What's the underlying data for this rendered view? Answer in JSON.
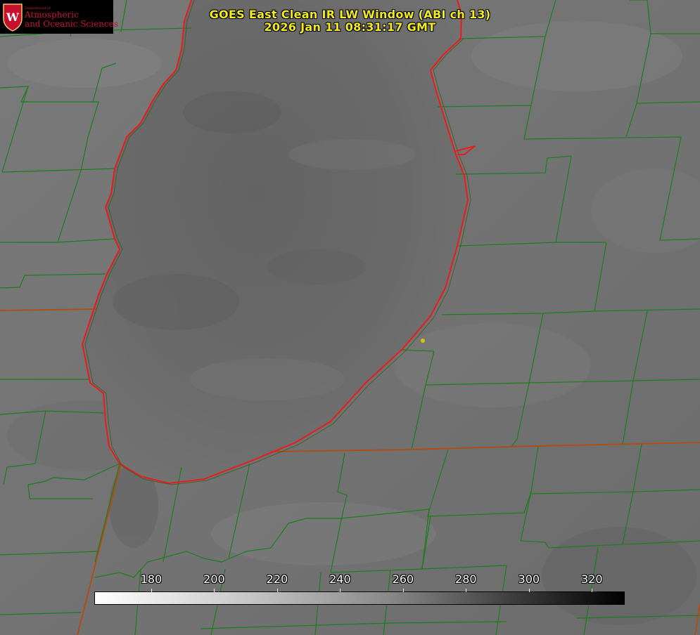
{
  "title": {
    "line1": "GOES East Clean IR LW Window (ABI ch 13)",
    "line2": "2026 Jan 11 08:31:17 GMT"
  },
  "logo": {
    "department": "Department of",
    "line1": "Atmospheric",
    "line2": "and Oceanic Sciences",
    "brand_color": "#c8102e"
  },
  "colorbar": {
    "unit_min": 161.9,
    "unit_max": 330,
    "ticks": [
      "180",
      "200",
      "220",
      "240",
      "260",
      "280",
      "300",
      "320"
    ]
  },
  "map": {
    "county_line_color": "#1c7d1c",
    "state_line_color": "#b34a10",
    "coastline_color": "#e81c1c",
    "station_marker_color": "#d4c21a",
    "lake_name": "",
    "background_gray": "#6e6e6e"
  }
}
